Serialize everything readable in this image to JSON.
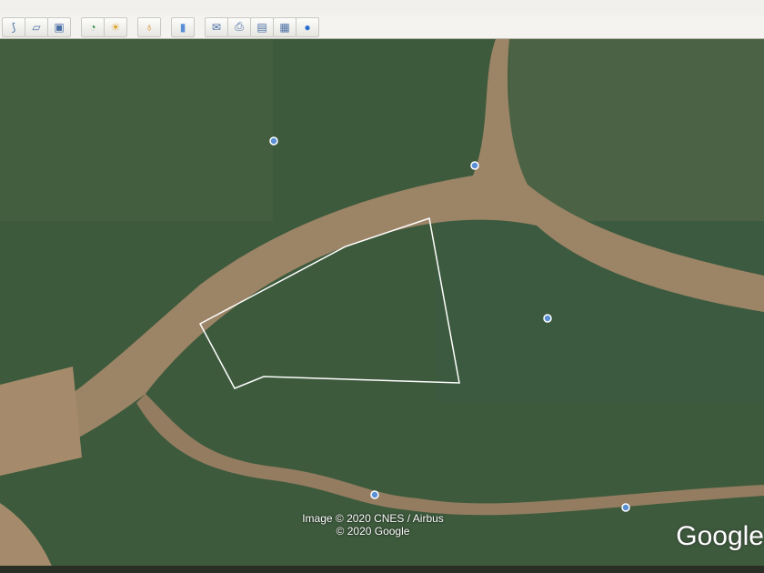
{
  "toolbar": {
    "groups": [
      [
        "add-path-icon",
        "add-polygon-icon",
        "add-overlay-icon"
      ],
      [
        "historical-imagery-icon",
        "sunlight-icon"
      ],
      [
        "planet-switch-icon"
      ],
      [
        "ruler-icon"
      ],
      [
        "email-icon",
        "print-icon",
        "save-image-icon",
        "view-in-maps-icon",
        "earth-icon"
      ]
    ],
    "glyphs": {
      "add-path-icon": "⟆",
      "add-polygon-icon": "▱",
      "add-overlay-icon": "▣",
      "historical-imagery-icon": "◔",
      "sunlight-icon": "☀",
      "planet-switch-icon": "♁",
      "ruler-icon": "▮",
      "email-icon": "✉",
      "print-icon": "⎙",
      "save-image-icon": "▤",
      "view-in-maps-icon": "▦",
      "earth-icon": "●"
    }
  },
  "map": {
    "attribution_line1": "Image © 2020 CNES / Airbus",
    "attribution_line2": "© 2020 Google",
    "logo": "Google",
    "colors": {
      "land": "#3d5a3c",
      "river": "#9c8466",
      "polygon": "#ffffff"
    }
  }
}
